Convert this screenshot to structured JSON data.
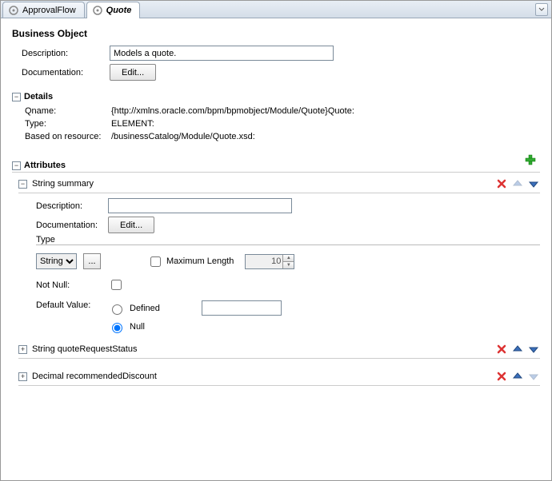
{
  "tabs": {
    "t0": {
      "label": "ApprovalFlow"
    },
    "t1": {
      "label": "Quote"
    }
  },
  "header": {
    "title": "Business Object"
  },
  "main": {
    "description_label": "Description:",
    "description_value": "Models a quote.",
    "documentation_label": "Documentation:",
    "edit_button": "Edit..."
  },
  "details": {
    "title": "Details",
    "qname_label": "Qname:",
    "qname_value": "{http://xmlns.oracle.com/bpm/bpmobject/Module/Quote}Quote:",
    "type_label": "Type:",
    "type_value": "ELEMENT:",
    "resource_label": "Based on resource:",
    "resource_value": "/businessCatalog/Module/Quote.xsd:"
  },
  "attributes": {
    "title": "Attributes",
    "items": [
      {
        "label": "String summary",
        "expanded": true,
        "up_disabled": true,
        "down_disabled": false,
        "body": {
          "description_label": "Description:",
          "description_value": "",
          "documentation_label": "Documentation:",
          "edit_button": "Edit...",
          "type_legend": "Type",
          "type_select": "String",
          "maxlen_label": "Maximum Length",
          "maxlen_value": "10",
          "notnull_label": "Not Null:",
          "default_label": "Default Value:",
          "radio_defined": "Defined",
          "radio_null": "Null"
        }
      },
      {
        "label": "String quoteRequestStatus",
        "expanded": false,
        "up_disabled": false,
        "down_disabled": false
      },
      {
        "label": "Decimal recommendedDiscount",
        "expanded": false,
        "up_disabled": false,
        "down_disabled": true
      }
    ]
  }
}
